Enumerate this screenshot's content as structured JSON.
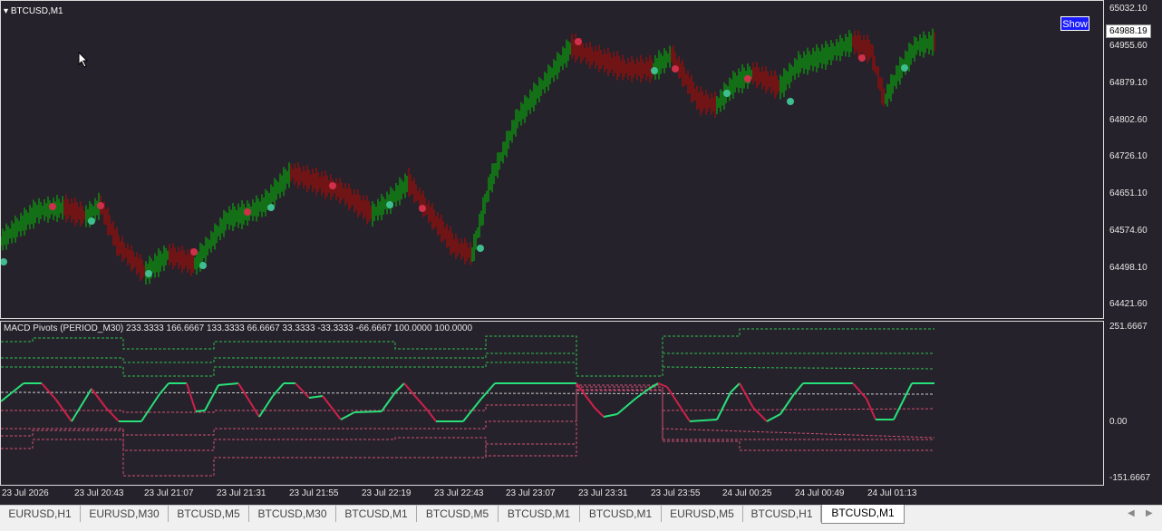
{
  "chart": {
    "symbol": "BTCUSD,M1",
    "show_button": "Show",
    "current_price": "64988.19",
    "price_labels": [
      "65032.10",
      "64955.60",
      "64879.10",
      "64802.60",
      "64726.10",
      "64651.10",
      "64574.60",
      "64498.10",
      "64421.60"
    ],
    "indicator_title": "MACD Pivots (PERIOD_M30) 233.3333 166.6667 133.3333 66.6667 33.3333 -33.3333 -66.6667 100.0000 100.0000",
    "indicator_labels": [
      "251.6667",
      "0.00",
      "-151.6667"
    ],
    "time_labels": [
      "23 Jul 2026",
      "23 Jul 20:43",
      "23 Jul 21:07",
      "23 Jul 21:31",
      "23 Jul 21:55",
      "23 Jul 22:19",
      "23 Jul 22:43",
      "23 Jul 23:07",
      "23 Jul 23:31",
      "23 Jul 23:55",
      "24 Jul 00:25",
      "24 Jul 00:49",
      "24 Jul 01:13"
    ],
    "colors": {
      "background": "#26222b",
      "bull": "#0f8a0f",
      "bear": "#8a0f0f",
      "macd_up": "#27e079",
      "macd_down": "#d0204a"
    }
  },
  "tabs": [
    {
      "label": "EURUSD,H1",
      "active": false
    },
    {
      "label": "EURUSD,M30",
      "active": false
    },
    {
      "label": "BTCUSD,M5",
      "active": false
    },
    {
      "label": "BTCUSD,M30",
      "active": false
    },
    {
      "label": "BTCUSD,M1",
      "active": false
    },
    {
      "label": "BTCUSD,M5",
      "active": false
    },
    {
      "label": "BTCUSD,M1",
      "active": false
    },
    {
      "label": "BTCUSD,M1",
      "active": false
    },
    {
      "label": "EURUSD,M5",
      "active": false
    },
    {
      "label": "BTCUSD,H1",
      "active": false
    },
    {
      "label": "BTCUSD,M1",
      "active": true
    }
  ],
  "icons": [
    "triangle-down-icon",
    "mouse-cursor-icon",
    "arrow-left-icon",
    "arrow-right-icon"
  ]
}
